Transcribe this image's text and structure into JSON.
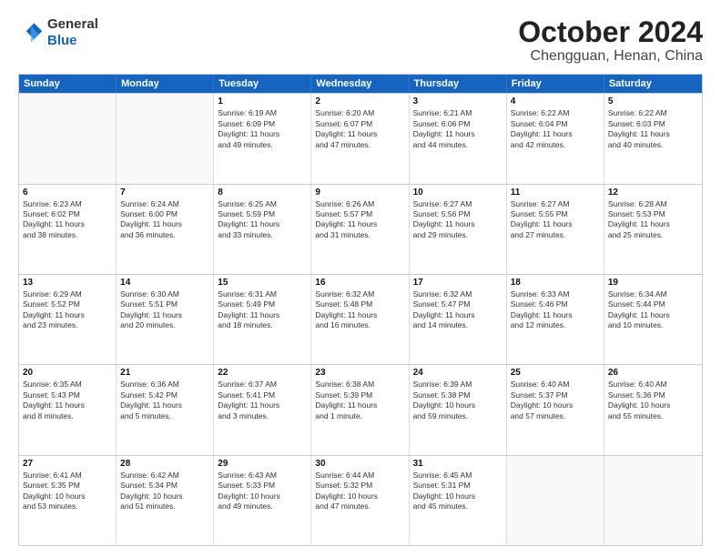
{
  "header": {
    "logo_general": "General",
    "logo_blue": "Blue",
    "month": "October 2024",
    "location": "Chengguan, Henan, China"
  },
  "weekdays": [
    "Sunday",
    "Monday",
    "Tuesday",
    "Wednesday",
    "Thursday",
    "Friday",
    "Saturday"
  ],
  "rows": [
    [
      {
        "day": "",
        "lines": [],
        "empty": true
      },
      {
        "day": "",
        "lines": [],
        "empty": true
      },
      {
        "day": "1",
        "lines": [
          "Sunrise: 6:19 AM",
          "Sunset: 6:09 PM",
          "Daylight: 11 hours",
          "and 49 minutes."
        ]
      },
      {
        "day": "2",
        "lines": [
          "Sunrise: 6:20 AM",
          "Sunset: 6:07 PM",
          "Daylight: 11 hours",
          "and 47 minutes."
        ]
      },
      {
        "day": "3",
        "lines": [
          "Sunrise: 6:21 AM",
          "Sunset: 6:06 PM",
          "Daylight: 11 hours",
          "and 44 minutes."
        ]
      },
      {
        "day": "4",
        "lines": [
          "Sunrise: 6:22 AM",
          "Sunset: 6:04 PM",
          "Daylight: 11 hours",
          "and 42 minutes."
        ]
      },
      {
        "day": "5",
        "lines": [
          "Sunrise: 6:22 AM",
          "Sunset: 6:03 PM",
          "Daylight: 11 hours",
          "and 40 minutes."
        ]
      }
    ],
    [
      {
        "day": "6",
        "lines": [
          "Sunrise: 6:23 AM",
          "Sunset: 6:02 PM",
          "Daylight: 11 hours",
          "and 38 minutes."
        ]
      },
      {
        "day": "7",
        "lines": [
          "Sunrise: 6:24 AM",
          "Sunset: 6:00 PM",
          "Daylight: 11 hours",
          "and 36 minutes."
        ]
      },
      {
        "day": "8",
        "lines": [
          "Sunrise: 6:25 AM",
          "Sunset: 5:59 PM",
          "Daylight: 11 hours",
          "and 33 minutes."
        ]
      },
      {
        "day": "9",
        "lines": [
          "Sunrise: 6:26 AM",
          "Sunset: 5:57 PM",
          "Daylight: 11 hours",
          "and 31 minutes."
        ]
      },
      {
        "day": "10",
        "lines": [
          "Sunrise: 6:27 AM",
          "Sunset: 5:56 PM",
          "Daylight: 11 hours",
          "and 29 minutes."
        ]
      },
      {
        "day": "11",
        "lines": [
          "Sunrise: 6:27 AM",
          "Sunset: 5:55 PM",
          "Daylight: 11 hours",
          "and 27 minutes."
        ]
      },
      {
        "day": "12",
        "lines": [
          "Sunrise: 6:28 AM",
          "Sunset: 5:53 PM",
          "Daylight: 11 hours",
          "and 25 minutes."
        ]
      }
    ],
    [
      {
        "day": "13",
        "lines": [
          "Sunrise: 6:29 AM",
          "Sunset: 5:52 PM",
          "Daylight: 11 hours",
          "and 23 minutes."
        ]
      },
      {
        "day": "14",
        "lines": [
          "Sunrise: 6:30 AM",
          "Sunset: 5:51 PM",
          "Daylight: 11 hours",
          "and 20 minutes."
        ]
      },
      {
        "day": "15",
        "lines": [
          "Sunrise: 6:31 AM",
          "Sunset: 5:49 PM",
          "Daylight: 11 hours",
          "and 18 minutes."
        ]
      },
      {
        "day": "16",
        "lines": [
          "Sunrise: 6:32 AM",
          "Sunset: 5:48 PM",
          "Daylight: 11 hours",
          "and 16 minutes."
        ]
      },
      {
        "day": "17",
        "lines": [
          "Sunrise: 6:32 AM",
          "Sunset: 5:47 PM",
          "Daylight: 11 hours",
          "and 14 minutes."
        ]
      },
      {
        "day": "18",
        "lines": [
          "Sunrise: 6:33 AM",
          "Sunset: 5:46 PM",
          "Daylight: 11 hours",
          "and 12 minutes."
        ]
      },
      {
        "day": "19",
        "lines": [
          "Sunrise: 6:34 AM",
          "Sunset: 5:44 PM",
          "Daylight: 11 hours",
          "and 10 minutes."
        ]
      }
    ],
    [
      {
        "day": "20",
        "lines": [
          "Sunrise: 6:35 AM",
          "Sunset: 5:43 PM",
          "Daylight: 11 hours",
          "and 8 minutes."
        ]
      },
      {
        "day": "21",
        "lines": [
          "Sunrise: 6:36 AM",
          "Sunset: 5:42 PM",
          "Daylight: 11 hours",
          "and 5 minutes."
        ]
      },
      {
        "day": "22",
        "lines": [
          "Sunrise: 6:37 AM",
          "Sunset: 5:41 PM",
          "Daylight: 11 hours",
          "and 3 minutes."
        ]
      },
      {
        "day": "23",
        "lines": [
          "Sunrise: 6:38 AM",
          "Sunset: 5:39 PM",
          "Daylight: 11 hours",
          "and 1 minute."
        ]
      },
      {
        "day": "24",
        "lines": [
          "Sunrise: 6:39 AM",
          "Sunset: 5:38 PM",
          "Daylight: 10 hours",
          "and 59 minutes."
        ]
      },
      {
        "day": "25",
        "lines": [
          "Sunrise: 6:40 AM",
          "Sunset: 5:37 PM",
          "Daylight: 10 hours",
          "and 57 minutes."
        ]
      },
      {
        "day": "26",
        "lines": [
          "Sunrise: 6:40 AM",
          "Sunset: 5:36 PM",
          "Daylight: 10 hours",
          "and 55 minutes."
        ]
      }
    ],
    [
      {
        "day": "27",
        "lines": [
          "Sunrise: 6:41 AM",
          "Sunset: 5:35 PM",
          "Daylight: 10 hours",
          "and 53 minutes."
        ]
      },
      {
        "day": "28",
        "lines": [
          "Sunrise: 6:42 AM",
          "Sunset: 5:34 PM",
          "Daylight: 10 hours",
          "and 51 minutes."
        ]
      },
      {
        "day": "29",
        "lines": [
          "Sunrise: 6:43 AM",
          "Sunset: 5:33 PM",
          "Daylight: 10 hours",
          "and 49 minutes."
        ]
      },
      {
        "day": "30",
        "lines": [
          "Sunrise: 6:44 AM",
          "Sunset: 5:32 PM",
          "Daylight: 10 hours",
          "and 47 minutes."
        ]
      },
      {
        "day": "31",
        "lines": [
          "Sunrise: 6:45 AM",
          "Sunset: 5:31 PM",
          "Daylight: 10 hours",
          "and 45 minutes."
        ]
      },
      {
        "day": "",
        "lines": [],
        "empty": true
      },
      {
        "day": "",
        "lines": [],
        "empty": true
      }
    ]
  ]
}
